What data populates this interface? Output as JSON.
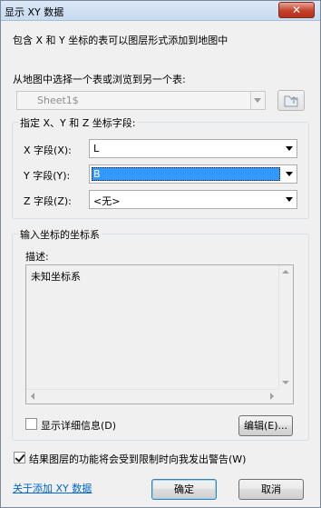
{
  "window": {
    "title": "显示 XY 数据",
    "close_glyph": "✕"
  },
  "intro_text": "包含 X 和 Y 坐标的表可以图层形式添加到地图中",
  "table_select": {
    "label": "从地图中选择一个表或浏览到另一个表:",
    "value": "Sheet1$",
    "browse_icon": "folder-browse-icon"
  },
  "fields_group": {
    "legend": "指定 X、Y 和 Z 坐标字段:",
    "x_label": "X 字段(X):",
    "x_value": "L",
    "y_label": "Y 字段(Y):",
    "y_value": "B",
    "z_label": "Z 字段(Z):",
    "z_value": "<无>"
  },
  "coord_group": {
    "legend": "输入坐标的坐标系",
    "desc_label": "描述:",
    "desc_text": "未知坐标系",
    "show_details_label": "显示详细信息(D)",
    "show_details_checked": false,
    "edit_button": "编辑(E)..."
  },
  "warn_checkbox": {
    "label": "结果图层的功能将会受到限制时向我发出警告(W)",
    "checked": true
  },
  "help_link": "关于添加 XY 数据",
  "ok_button": "确定",
  "cancel_button": "取消",
  "colors": {
    "selection": "#3399ff",
    "link": "#0066cc",
    "close_button": "#c4412a"
  }
}
